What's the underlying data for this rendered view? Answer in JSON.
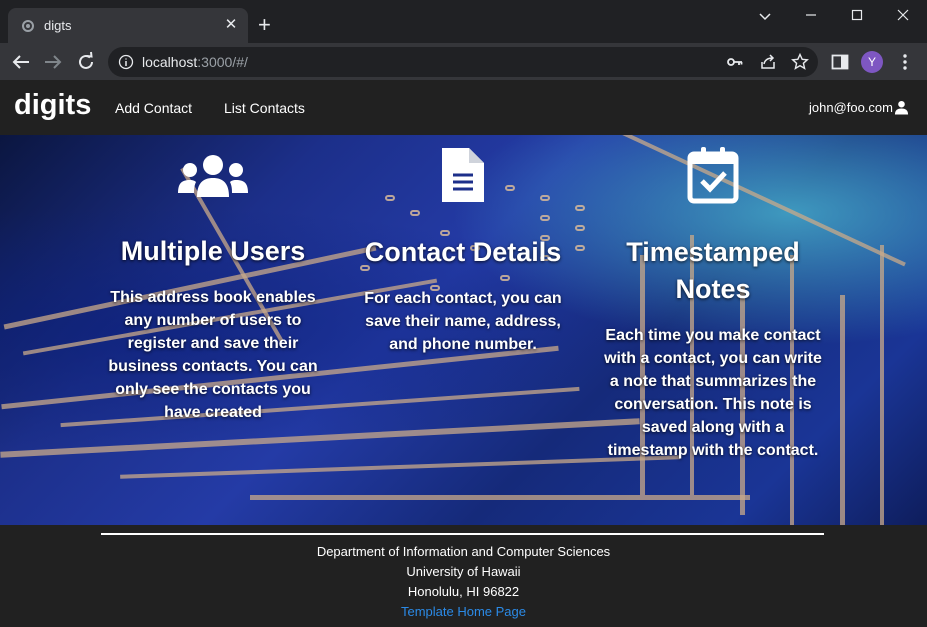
{
  "browser": {
    "tab_title": "digts",
    "tab_close": "✕",
    "new_tab": "+",
    "url_host": "localhost",
    "url_rest": ":3000/#/",
    "profile_initial": "Y"
  },
  "navbar": {
    "brand": "digits",
    "links": [
      "Add Contact",
      "List Contacts"
    ],
    "user": "john@foo.com"
  },
  "features": [
    {
      "icon": "users-icon",
      "title": "Multiple Users",
      "text": "This address book enables any number of users to register and save their business contacts. You can only see the contacts you have created"
    },
    {
      "icon": "file-lines-icon",
      "title": "Contact Details",
      "text": "For each contact, you can save their name, address, and phone number."
    },
    {
      "icon": "calendar-check-icon",
      "title": "Timestamped Notes",
      "text": "Each time you make contact with a contact, you can write a note that summarizes the conversation. This note is saved along with a timestamp with the contact."
    }
  ],
  "footer": {
    "line1": "Department of Information and Computer Sciences",
    "line2": "University of Hawaii",
    "line3": "Honolulu, HI 96822",
    "link": "Template Home Page"
  }
}
